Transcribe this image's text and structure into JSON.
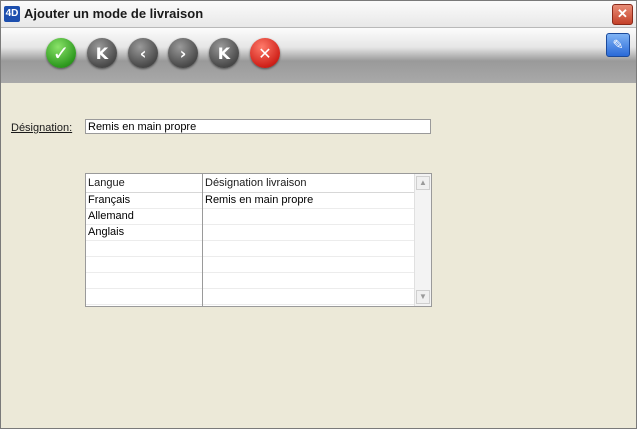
{
  "window": {
    "title": "Ajouter un mode de livraison",
    "app_icon_text": "4D",
    "close_glyph": "✕"
  },
  "toolbar": {
    "validate_glyph": "✓",
    "first_glyph": "K",
    "prev_glyph": "‹",
    "next_glyph": "›",
    "last_glyph": "K",
    "cancel_glyph": "✕",
    "edit_glyph": "✎"
  },
  "form": {
    "designation_label": "Désignation:",
    "designation_value": "Remis en main propre"
  },
  "table": {
    "columns": [
      "Langue",
      "Désignation livraison"
    ],
    "rows": [
      {
        "langue": "Français",
        "designation": "Remis en main propre"
      },
      {
        "langue": "Allemand",
        "designation": ""
      },
      {
        "langue": "Anglais",
        "designation": ""
      }
    ],
    "empty_row_count": 4,
    "scroll_up_glyph": "▲",
    "scroll_down_glyph": "▼"
  },
  "colors": {
    "accent": "#2a6ad8",
    "validate": "#2e9a1f",
    "cancel": "#d0221a"
  }
}
